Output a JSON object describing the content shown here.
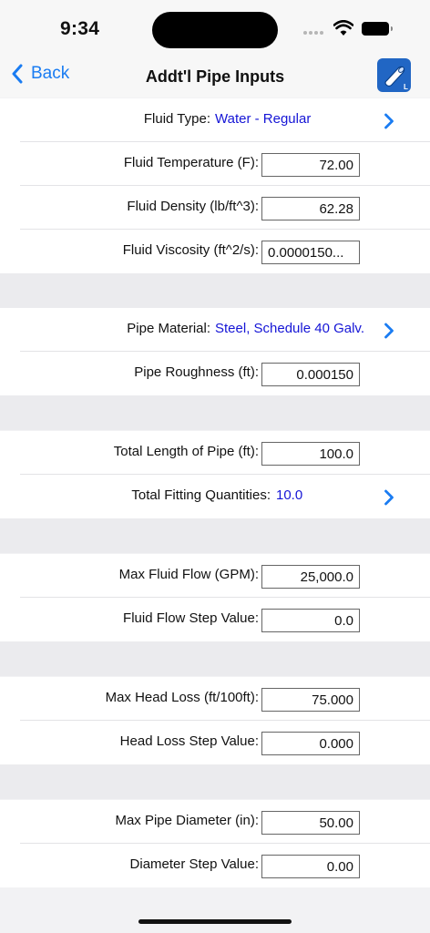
{
  "status": {
    "time": "9:34"
  },
  "nav": {
    "back_label": "Back",
    "title": "Addt'l Pipe Inputs",
    "app_icon": "pipe-app-icon",
    "app_icon_badge": "L"
  },
  "fluid": {
    "type_label": "Fluid Type:",
    "type_value": "Water - Regular",
    "temperature_label": "Fluid Temperature (F):",
    "temperature_value": "72.00",
    "density_label": "Fluid Density (lb/ft^3):",
    "density_value": "62.28",
    "viscosity_label": "Fluid Viscosity (ft^2/s):",
    "viscosity_value": "0.0000150..."
  },
  "pipe": {
    "material_label": "Pipe Material:",
    "material_value": "Steel, Schedule 40 Galv.",
    "roughness_label": "Pipe Roughness (ft):",
    "roughness_value": "0.000150"
  },
  "length": {
    "total_length_label": "Total Length of Pipe (ft):",
    "total_length_value": "100.0",
    "fittings_label": "Total Fitting Quantities:",
    "fittings_value": "10.0"
  },
  "flow": {
    "max_flow_label": "Max Fluid Flow (GPM):",
    "max_flow_value": "25,000.0",
    "flow_step_label": "Fluid Flow Step Value:",
    "flow_step_value": "0.0"
  },
  "head_loss": {
    "max_label": "Max Head Loss (ft/100ft):",
    "max_value": "75.000",
    "step_label": "Head Loss Step Value:",
    "step_value": "0.000"
  },
  "diameter": {
    "max_label": "Max Pipe Diameter (in):",
    "max_value": "50.00",
    "step_label": "Diameter Step Value:",
    "step_value": "0.00"
  },
  "colors": {
    "accent": "#1a7cf2",
    "link_value": "#1515d6",
    "group_bg": "#ebebee",
    "icon_bg": "#2166c4"
  }
}
